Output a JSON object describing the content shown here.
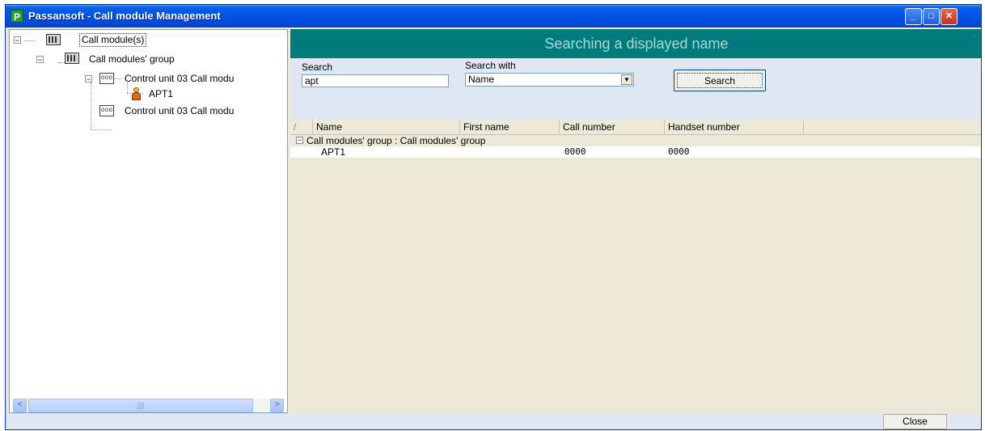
{
  "window": {
    "title": "Passansoft - Call module Management",
    "app_icon_letter": "P",
    "min_glyph": "_",
    "max_glyph": "□",
    "close_glyph": "✕"
  },
  "tree": {
    "root": {
      "label": "Call module(s)",
      "icon": "building-icon"
    },
    "group": {
      "label": "Call modules' group",
      "icon": "building-icon"
    },
    "unit1": {
      "label": "Control unit 03 Call modu",
      "icon": "control-unit-icon"
    },
    "resident": {
      "label": "APT1",
      "icon": "person-icon"
    },
    "unit2": {
      "label": "Control unit 03 Call modu",
      "icon": "control-unit-icon"
    },
    "scroll_left": "<",
    "scroll_right": ">",
    "scroll_grip": "||||"
  },
  "search_panel": {
    "header": "Searching a displayed name",
    "search_label": "Search",
    "search_value": "apt",
    "search_with_label": "Search with",
    "search_with_value": "Name",
    "search_button": "Search"
  },
  "results": {
    "sort_glyph": "/",
    "columns": [
      "Name",
      "First name",
      "Call number",
      "Handset number"
    ],
    "group_label": "Call modules' group : Call modules' group",
    "rows": [
      {
        "name": "APT1",
        "first_name": "",
        "call_number": "0000",
        "handset_number": "0000"
      }
    ]
  },
  "footer": {
    "close_button": "Close"
  },
  "colors": {
    "title_bar": "#0053e6",
    "header_band": "#007b7b",
    "header_text": "#a8d8d8",
    "panel_bg": "#ece9d8",
    "search_bg": "#dfe8f2"
  }
}
